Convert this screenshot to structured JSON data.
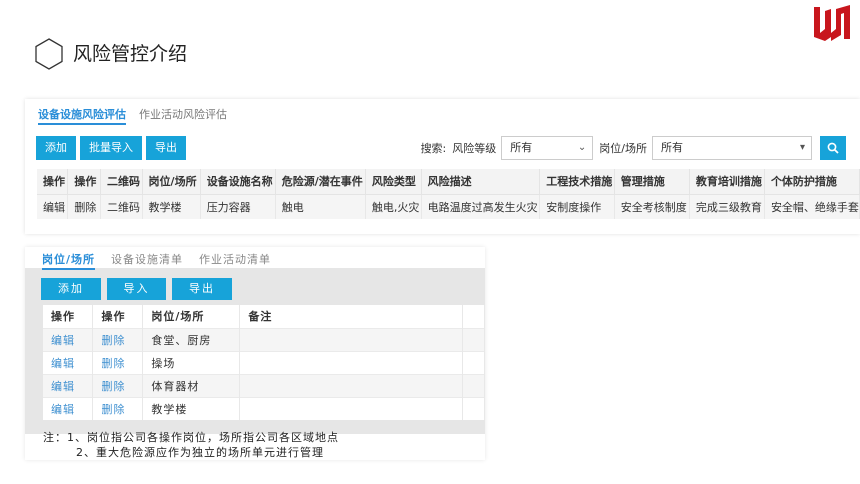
{
  "slide": {
    "title": "风险管控介绍"
  },
  "colors": {
    "accent": "#17a3d9",
    "link": "#3d8fd0",
    "logo": "#c8161d"
  },
  "top_panel": {
    "tabs": [
      "设备设施风险评估",
      "作业活动风险评估"
    ],
    "buttons": [
      "添加",
      "批量导入",
      "导出"
    ],
    "search_label": "搜索:",
    "risk_level_label": "风险等级",
    "risk_level_value": "所有",
    "post_label": "岗位/场所",
    "post_value": "所有",
    "columns": [
      "操作",
      "操作",
      "二维码",
      "岗位/场所",
      "设备设施名称",
      "危险源/潜在事件",
      "风险类型",
      "风险描述",
      "工程技术措施",
      "管理措施",
      "教育培训措施",
      "个体防护措施"
    ],
    "row": [
      "编辑",
      "删除",
      "二维码",
      "教学楼",
      "压力容器",
      "触电",
      "触电,火灾",
      "电路温度过高发生火灾",
      "安制度操作",
      "安全考核制度",
      "完成三级教育",
      "安全帽、绝缘手套"
    ]
  },
  "bottom_panel": {
    "tabs": [
      "岗位/场所",
      "设备设施清单",
      "作业活动清单"
    ],
    "buttons": [
      "添加",
      "导入",
      "导出"
    ],
    "columns": [
      "操作",
      "操作",
      "岗位/场所",
      "备注"
    ],
    "rows": [
      [
        "编辑",
        "删除",
        "食堂、厨房",
        ""
      ],
      [
        "编辑",
        "删除",
        "操场",
        ""
      ],
      [
        "编辑",
        "删除",
        "体育器材",
        ""
      ],
      [
        "编辑",
        "删除",
        "教学楼",
        ""
      ]
    ]
  },
  "notes": {
    "line1": "注：1、岗位指公司各操作岗位，场所指公司各区域地点",
    "line2": "2、重大危险源应作为独立的场所单元进行管理"
  }
}
